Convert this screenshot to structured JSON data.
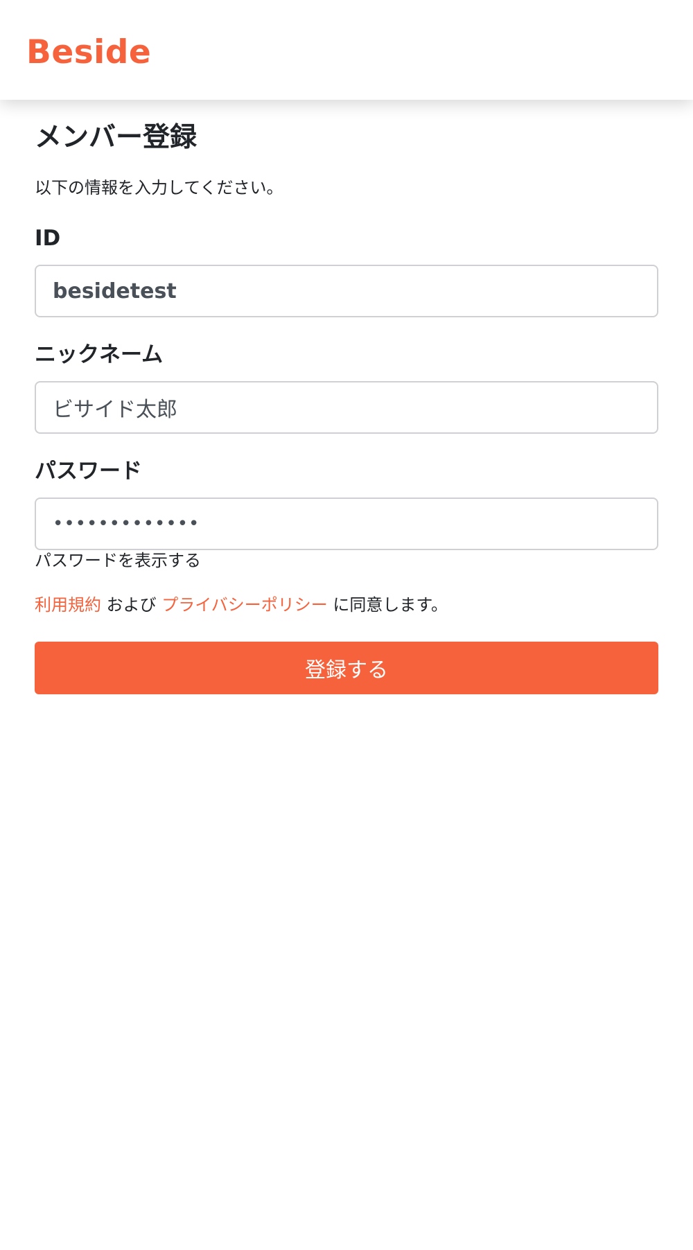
{
  "header": {
    "logo_text": "Beside"
  },
  "page": {
    "title": "メンバー登録",
    "intro": "以下の情報を入力してください。"
  },
  "form": {
    "id": {
      "label": "ID",
      "value": "besidetest"
    },
    "nickname": {
      "label": "ニックネーム",
      "value": "ビサイド太郎"
    },
    "password": {
      "label": "パスワード",
      "value": "•••••••••••••"
    },
    "show_password_label": "パスワードを表示する",
    "agreement": {
      "terms_link": "利用規約",
      "and_text": " および ",
      "privacy_link": "プライバシーポリシー",
      "suffix": " に同意します。"
    },
    "submit_label": "登録する"
  },
  "colors": {
    "accent": "#f5623c",
    "text": "#212529",
    "input_border": "#ced0d3"
  }
}
